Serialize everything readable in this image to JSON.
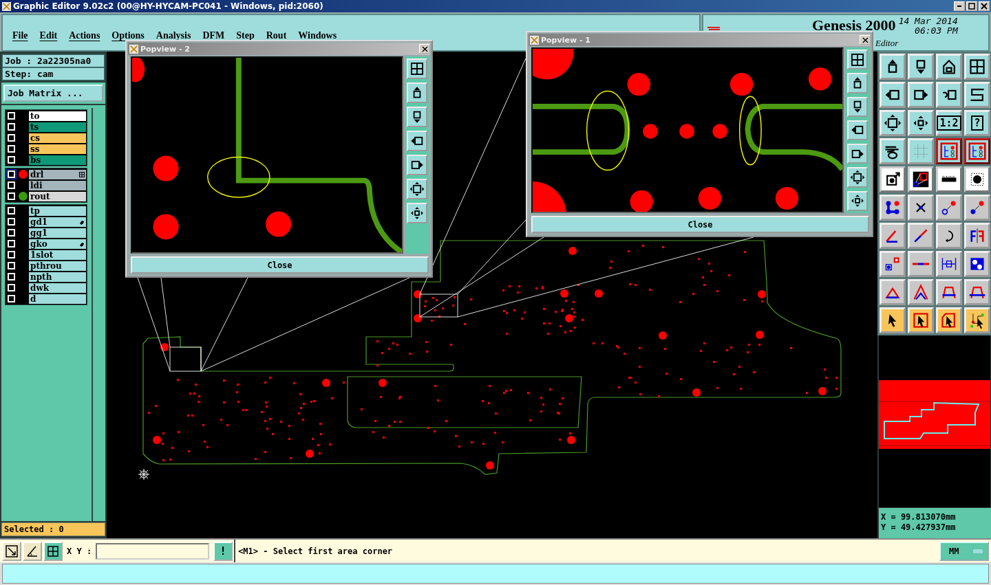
{
  "window": {
    "title": "Graphic Editor 9.02c2 (00@HY-HYCAM-PC041 - Windows, pid:2060)"
  },
  "menu": [
    "File",
    "Edit",
    "Actions",
    "Options",
    "Analysis",
    "DFM",
    "Step",
    "Rout",
    "Windows"
  ],
  "header": {
    "product": "Genesis 2000",
    "date": "14 Mar 2014",
    "time": "06:03 PM",
    "module": "Editor"
  },
  "job": {
    "job": "Job : 2a22305na0",
    "step": "Step: cam",
    "matrix_button": "Job Matrix ..."
  },
  "layer_groups": [
    [
      {
        "name": "to",
        "color": "#ffffff",
        "checked": false,
        "selected": false
      },
      {
        "name": "ts",
        "color": "#0e9a78",
        "checked": false,
        "selected": false
      },
      {
        "name": "cs",
        "color": "#f8c55a",
        "checked": false,
        "selected": false
      },
      {
        "name": "ss",
        "color": "#f8c55a",
        "checked": false,
        "selected": false
      },
      {
        "name": "bs",
        "color": "#0e9a78",
        "checked": false,
        "selected": false
      }
    ],
    [
      {
        "name": "drl",
        "color": "#a3b5bb",
        "checked": false,
        "selected": true,
        "dot": {
          "color": "#ff0000"
        },
        "marker": {
          "kind": "grid"
        }
      },
      {
        "name": "ldi",
        "color": "#a3b5bb",
        "checked": false,
        "selected": false
      },
      {
        "name": "rout",
        "color": "#d8d8d8",
        "checked": false,
        "selected": false,
        "dot": {
          "color": "#3a9a10"
        }
      }
    ],
    [
      {
        "name": "tp",
        "color": "#9fdcdc",
        "checked": false,
        "selected": false
      },
      {
        "name": "gd1",
        "color": "#9fdcdc",
        "checked": false,
        "selected": false,
        "marker": {
          "kind": "hand"
        }
      },
      {
        "name": "gg1",
        "color": "#9fdcdc",
        "checked": false,
        "selected": false
      },
      {
        "name": "gko",
        "color": "#9fdcdc",
        "checked": false,
        "selected": false,
        "marker": {
          "kind": "hand"
        }
      },
      {
        "name": "1slot",
        "color": "#9fdcdc",
        "checked": false,
        "selected": false
      },
      {
        "name": "pthrou",
        "color": "#9fdcdc",
        "checked": false,
        "selected": false
      },
      {
        "name": "npth",
        "color": "#9fdcdc",
        "checked": false,
        "selected": false
      },
      {
        "name": "dwk",
        "color": "#9fdcdc",
        "checked": false,
        "selected": false
      },
      {
        "name": "d",
        "color": "#9fdcdc",
        "checked": false,
        "selected": false
      }
    ]
  ],
  "selected_count": "Selected : 0",
  "popviews": [
    {
      "title": "Popview - 2",
      "close": "Close",
      "kind": "corner"
    },
    {
      "title": "Popview - 1",
      "close": "Close",
      "kind": "slot"
    }
  ],
  "tools": [
    {
      "kind": "up"
    },
    {
      "kind": "down"
    },
    {
      "kind": "home"
    },
    {
      "kind": "panes"
    },
    {
      "kind": "left"
    },
    {
      "kind": "right"
    },
    {
      "kind": "undo"
    },
    {
      "kind": "curve"
    },
    {
      "kind": "fit"
    },
    {
      "kind": "center"
    },
    {
      "kind": "text",
      "label": "1:2"
    },
    {
      "kind": "text",
      "label": "?"
    },
    {
      "kind": "palette"
    },
    {
      "kind": "grid"
    },
    {
      "kind": "layers"
    },
    {
      "kind": "layers"
    },
    {
      "kind": "snap"
    },
    {
      "kind": "window"
    },
    {
      "kind": "ruler"
    },
    {
      "kind": "pad"
    },
    {
      "kind": "nodes"
    },
    {
      "kind": "cross"
    },
    {
      "kind": "move-open"
    },
    {
      "kind": "move-dot"
    },
    {
      "kind": "angle"
    },
    {
      "kind": "diagonal"
    },
    {
      "kind": "rotate"
    },
    {
      "kind": "mirror"
    },
    {
      "kind": "box-move"
    },
    {
      "kind": "line"
    },
    {
      "kind": "measure"
    },
    {
      "kind": "shapes"
    },
    {
      "kind": "triangle"
    },
    {
      "kind": "peak"
    },
    {
      "kind": "arch"
    },
    {
      "kind": "arch-cross"
    },
    {
      "kind": "pointer"
    },
    {
      "kind": "pointer-box"
    },
    {
      "kind": "pointer-poly"
    },
    {
      "kind": "pointer-net"
    }
  ],
  "coords": {
    "x": "X  =  99.813070mm",
    "y": "Y  =  49.427937mm"
  },
  "command": {
    "label": "X Y :",
    "alert": "!",
    "prompt": "<M1> - Select first area corner",
    "units": "MM"
  }
}
